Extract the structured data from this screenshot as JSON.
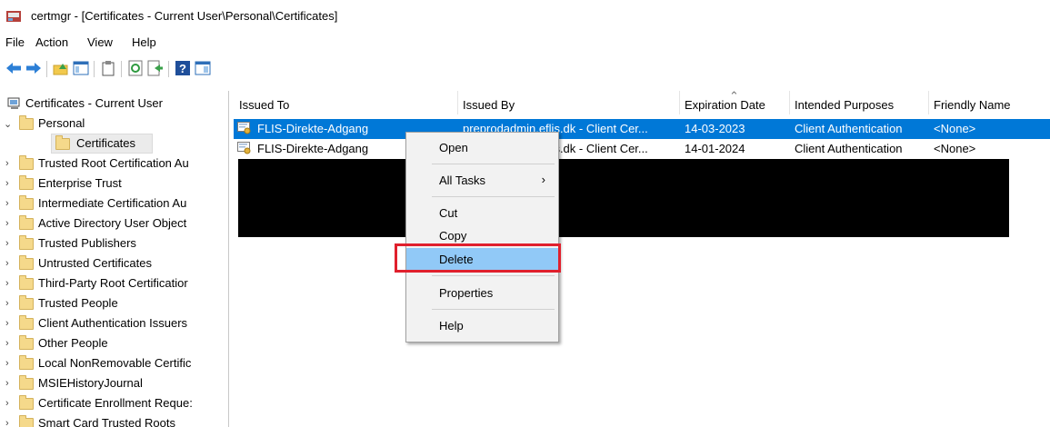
{
  "window": {
    "title": "certmgr - [Certificates - Current User\\Personal\\Certificates]"
  },
  "menu": [
    "File",
    "Action",
    "View",
    "Help"
  ],
  "toolbar_icons": [
    "back-arrow-icon",
    "forward-arrow-icon",
    "up-folder-icon",
    "show-hide-tree-icon",
    "properties-icon",
    "refresh-icon",
    "export-list-icon",
    "help-icon",
    "console-icon"
  ],
  "tree": {
    "root": "Certificates - Current User",
    "personal": "Personal",
    "certificates": "Certificates",
    "items": [
      "Trusted Root Certification Au",
      "Enterprise Trust",
      "Intermediate Certification Au",
      "Active Directory User Object",
      "Trusted Publishers",
      "Untrusted Certificates",
      "Third-Party Root Certificatior",
      "Trusted People",
      "Client Authentication Issuers",
      "Other People",
      "Local NonRemovable Certific",
      "MSIEHistoryJournal",
      "Certificate Enrollment Reque:",
      "Smart Card Trusted Roots"
    ]
  },
  "columns": [
    "Issued To",
    "Issued By",
    "Expiration Date",
    "Intended Purposes",
    "Friendly Name"
  ],
  "rows": [
    {
      "issued_to": "FLIS-Direkte-Adgang",
      "issued_by": "preprodadmin.eflis.dk - Client Cer...",
      "expiration": "14-03-2023",
      "purposes": "Client Authentication",
      "friendly": "<None>",
      "selected": true
    },
    {
      "issued_to": "FLIS-Direkte-Adgang",
      "issued_by": "preprodadmin.eflis.dk - Client Cer...",
      "expiration": "14-01-2024",
      "purposes": "Client Authentication",
      "friendly": "<None>",
      "selected": false
    }
  ],
  "context_menu": {
    "open": "Open",
    "all_tasks": "All Tasks",
    "cut": "Cut",
    "copy": "Copy",
    "delete": "Delete",
    "properties": "Properties",
    "help": "Help",
    "highlighted": "Delete"
  },
  "colors": {
    "selection": "#0078d7",
    "menu_highlight": "#91c9f7",
    "callout": "#e0202d"
  }
}
